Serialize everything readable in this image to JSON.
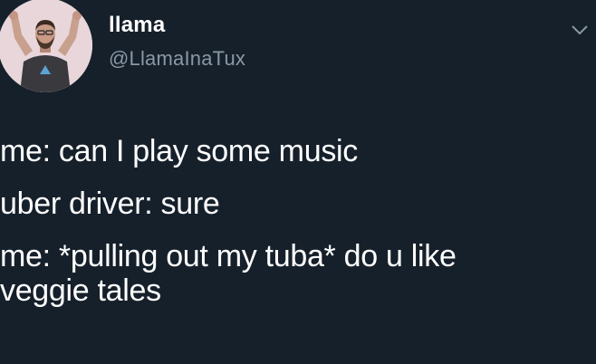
{
  "tweet": {
    "author": {
      "display_name": "llama",
      "handle": "@LlamaInaTux",
      "avatar_icon": "user-avatar-icon"
    },
    "menu_icon": "chevron-down-icon",
    "lines": [
      "me: can I play some music",
      "uber driver: sure",
      "me: *pulling out my tuba* do u like",
      "veggie tales"
    ]
  },
  "colors": {
    "background": "#16202b",
    "text": "#ffffff",
    "secondary_text": "#8899a6"
  }
}
